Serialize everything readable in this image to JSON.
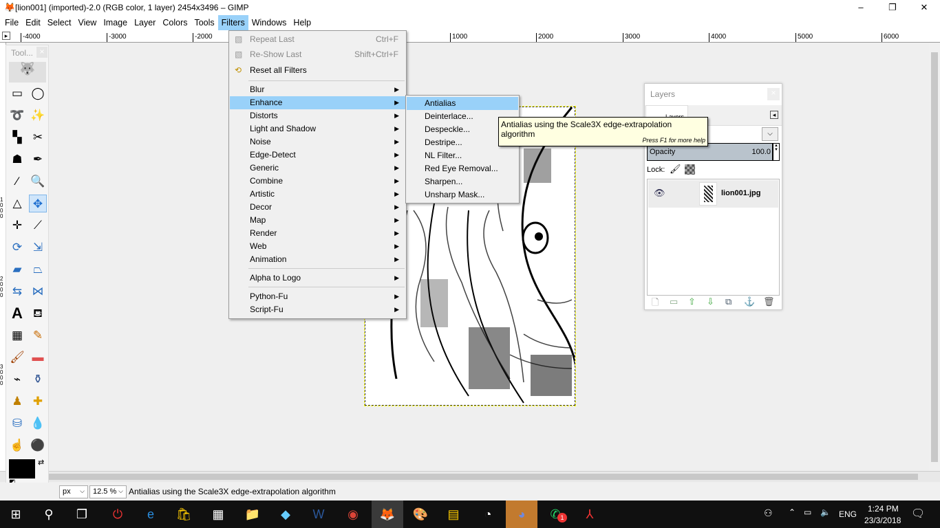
{
  "window": {
    "title": "[lion001] (imported)-2.0 (RGB color, 1 layer) 2454x3496 – GIMP",
    "minimize": "–",
    "maximize": "❐",
    "close": "✕"
  },
  "menubar": [
    "File",
    "Edit",
    "Select",
    "View",
    "Image",
    "Layer",
    "Colors",
    "Tools",
    "Filters",
    "Windows",
    "Help"
  ],
  "ruler": {
    "labels": [
      "-4000",
      "-3000",
      "-2000",
      "1000",
      "2000",
      "3000",
      "4000",
      "5000",
      "6000"
    ],
    "vertical": [
      "1000",
      "2000",
      "3000"
    ]
  },
  "toolbox": {
    "title": "Tool...",
    "close": "×"
  },
  "filters_menu": {
    "top": [
      {
        "label": "Repeat Last",
        "shortcut": "Ctrl+F",
        "disabled": true
      },
      {
        "label": "Re-Show Last",
        "shortcut": "Shift+Ctrl+F",
        "disabled": true
      },
      {
        "label": "Reset all Filters",
        "shortcut": ""
      }
    ],
    "groups": [
      "Blur",
      "Enhance",
      "Distorts",
      "Light and Shadow",
      "Noise",
      "Edge-Detect",
      "Generic",
      "Combine",
      "Artistic",
      "Decor",
      "Map",
      "Render",
      "Web",
      "Animation"
    ],
    "logo": "Alpha to Logo",
    "scripts": [
      "Python-Fu",
      "Script-Fu"
    ],
    "highlighted": "Enhance"
  },
  "enhance_menu": {
    "items": [
      "Antialias",
      "Deinterlace...",
      "Despeckle...",
      "Destripe...",
      "NL Filter...",
      "Red Eye Removal...",
      "Sharpen...",
      "Unsharp Mask..."
    ],
    "highlighted": "Antialias"
  },
  "tooltip": {
    "text": "Antialias using the Scale3X edge-extrapolation algorithm",
    "help": "Press F1 for more help"
  },
  "layers_panel": {
    "title": "Layers",
    "tab": "Layers",
    "opacity_label": "Opacity",
    "opacity_value": "100.0",
    "lock_label": "Lock:",
    "layer_name": "lion001.jpg"
  },
  "statusbar": {
    "unit": "px",
    "zoom": "12.5 %",
    "message": "Antialias using the Scale3X edge-extrapolation algorithm"
  },
  "taskbar": {
    "time": "1:24 PM",
    "date": "23/3/2018",
    "language": "ENG",
    "whatsapp_badge": "1"
  }
}
